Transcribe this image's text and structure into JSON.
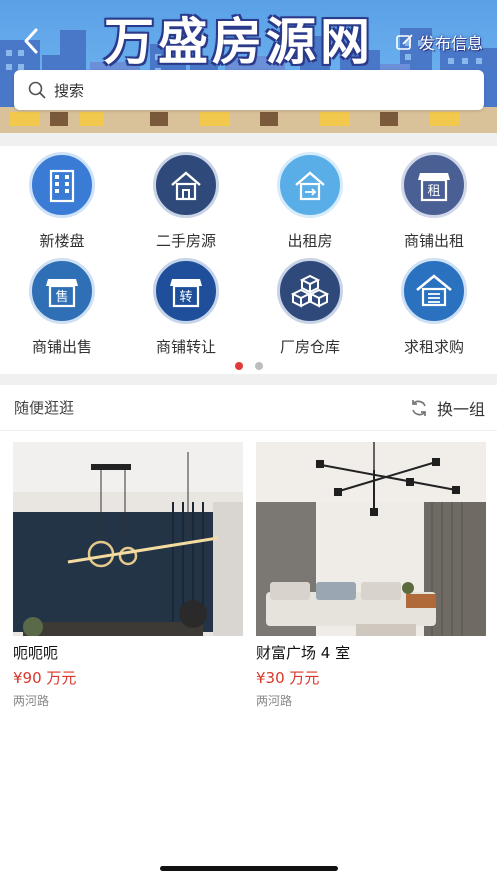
{
  "header": {
    "brand_title": "万盛房源网",
    "publish_label": "发布信息",
    "back_icon": "chevron-left-icon",
    "publish_icon": "edit-icon"
  },
  "search": {
    "placeholder": "搜索",
    "icon": "search-icon"
  },
  "categories": [
    {
      "label": "新楼盘",
      "icon": "building-icon",
      "color": "#3a7bd5"
    },
    {
      "label": "二手房源",
      "icon": "house-icon",
      "color": "#2f4a7a"
    },
    {
      "label": "出租房",
      "icon": "rent-house-icon",
      "color": "#5aaee8"
    },
    {
      "label": "商铺出租",
      "icon": "shop-rent-icon",
      "color": "#4a5f93"
    },
    {
      "label": "商铺出售",
      "icon": "shop-sale-icon",
      "color": "#2f6fb6"
    },
    {
      "label": "商铺转让",
      "icon": "shop-transfer-icon",
      "color": "#1f4f9a"
    },
    {
      "label": "厂房仓库",
      "icon": "warehouse-icon",
      "color": "#2f4a7a"
    },
    {
      "label": "求租求购",
      "icon": "request-icon",
      "color": "#2a72c0"
    }
  ],
  "category_icon_glyphs": {
    "shop_rent": "租",
    "shop_sale": "售",
    "shop_transfer": "转"
  },
  "pager": {
    "active_color": "#e03a3a",
    "inactive_color": "#bdbdbd",
    "pages": 2,
    "active": 1
  },
  "section": {
    "title": "随便逛逛",
    "refresh_label": "换一组",
    "refresh_icon": "refresh-icon"
  },
  "listings": [
    {
      "name": "呃呃呃",
      "price": "¥90 万元",
      "address": "两河路",
      "image": "dining-room-pendant-lamp-photo"
    },
    {
      "name": "财富广场 4 室",
      "price": "¥30 万元",
      "address": "两河路",
      "image": "living-room-chandelier-photo"
    }
  ],
  "colors": {
    "price": "#d9372b",
    "banner_sky": "#5aa0e6"
  }
}
